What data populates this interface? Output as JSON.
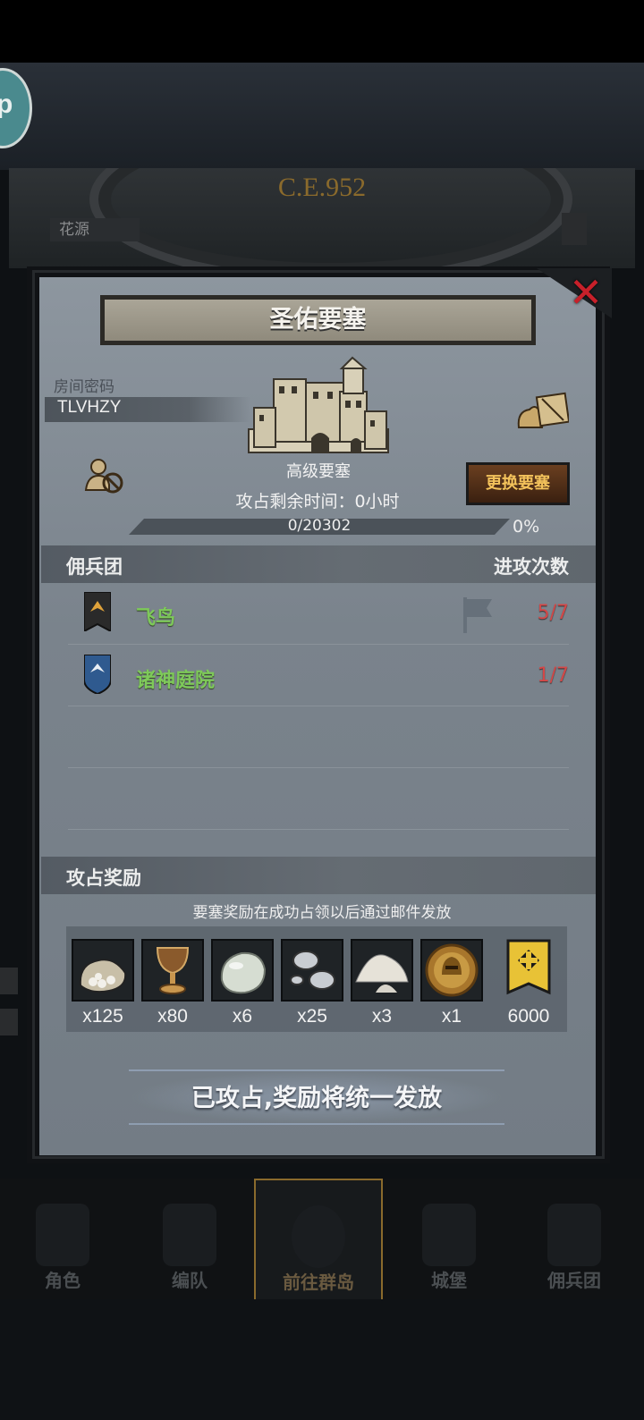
{
  "background": {
    "era_label": "C.E.952",
    "location_label": "花源"
  },
  "modal": {
    "title": "圣佑要塞",
    "room": {
      "label": "房间密码",
      "code": "TLVHZY"
    },
    "fortress": {
      "level": "高级要塞",
      "timer_label": "攻占剩余时间：",
      "timer_value": "0小时",
      "change_button": "更换要塞"
    },
    "progress": {
      "text": "0/20302",
      "percent_text": "0%",
      "fraction": 0
    },
    "mercenary_section": {
      "left": "佣兵团",
      "right": "进攻次数"
    },
    "guilds": [
      {
        "name": "飞鸟",
        "attacks": "5/7",
        "banner_color": "#2a2a2a",
        "emblem_color": "#e0a23a",
        "flag": true
      },
      {
        "name": "诸神庭院",
        "attacks": "1/7",
        "banner_color": "#2f5a8f",
        "emblem_color": "#e8eef5",
        "flag": false
      }
    ],
    "reward_section": {
      "title": "攻占奖励",
      "note": "要塞奖励在成功占领以后通过邮件发放"
    },
    "rewards": [
      {
        "icon": "coin-sack-icon",
        "qty": "x125"
      },
      {
        "icon": "goblet-icon",
        "qty": "x80"
      },
      {
        "icon": "pale-stone-icon",
        "qty": "x6"
      },
      {
        "icon": "silver-orbs-icon",
        "qty": "x25"
      },
      {
        "icon": "powder-pile-icon",
        "qty": "x3"
      },
      {
        "icon": "helmet-coin-icon",
        "qty": "x1"
      },
      {
        "icon": "gold-banner-icon",
        "qty": "6000"
      }
    ],
    "final_status": "已攻占,奖励将统一发放"
  },
  "bottom_nav": [
    {
      "label": "角色"
    },
    {
      "label": "编队"
    },
    {
      "label": "前往群岛",
      "active": true
    },
    {
      "label": "城堡"
    },
    {
      "label": "佣兵团"
    }
  ],
  "colors": {
    "accent_gold": "#f3c25b",
    "guild_green": "#7ec95a",
    "attack_red": "#d34848",
    "close_red": "#c8202a"
  }
}
